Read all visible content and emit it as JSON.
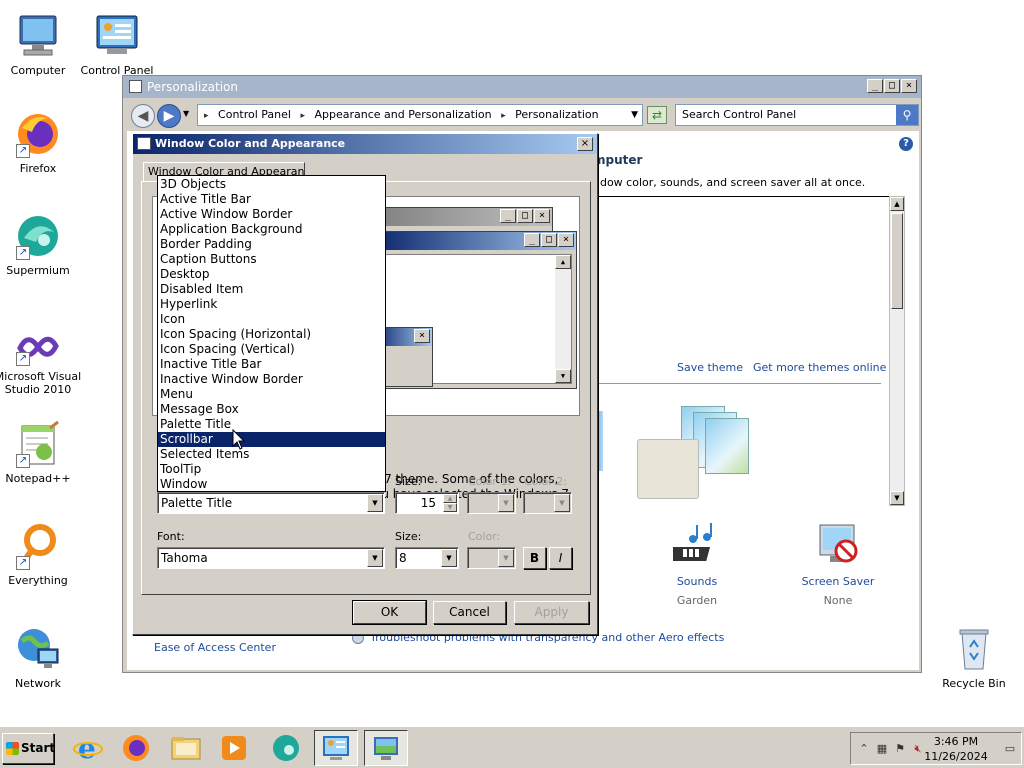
{
  "desktop": {
    "icons": [
      {
        "label": "Computer"
      },
      {
        "label": "Control Panel"
      },
      {
        "label": "Firefox"
      },
      {
        "label": "Supermium"
      },
      {
        "label": "Microsoft Visual Studio 2010"
      },
      {
        "label": "Notepad++"
      },
      {
        "label": "Everything"
      },
      {
        "label": "Network"
      },
      {
        "label": "Recycle Bin"
      }
    ]
  },
  "personalization": {
    "title": "Personalization",
    "breadcrumbs": [
      "Control Panel",
      "Appearance and Personalization",
      "Personalization"
    ],
    "search_placeholder": "Search Control Panel",
    "heading_partial": "mputer",
    "subheading_partial": "ndow color, sounds, and screen saver all at once.",
    "save_theme": "Save theme",
    "get_more_themes": "Get more themes online",
    "sounds": {
      "label": "Sounds",
      "value": "Garden"
    },
    "screen_saver": {
      "label": "Screen Saver",
      "value": "None"
    },
    "ease_of_access": "Ease of Access Center",
    "troubleshoot": "Troubleshoot problems with transparency and other Aero effects"
  },
  "dialog": {
    "title": "Window Color and Appearance",
    "tab_label": "Window Color and Appearance",
    "description_line1": "s 7 theme.  Some of the colors,",
    "description_line2": "ou have selected the Windows 7",
    "item_selected": "Palette Title",
    "size_label": "Size:",
    "item_size": "15",
    "color1_label": "Color 1:",
    "color2_label": "Color 2:",
    "font_label": "Font:",
    "font_value": "Tahoma",
    "font_size_label": "Size:",
    "font_size": "8",
    "color_label": "Color:",
    "bold_label": "B",
    "italic_label": "I",
    "ok": "OK",
    "cancel": "Cancel",
    "apply": "Apply",
    "item_options": [
      "3D Objects",
      "Active Title Bar",
      "Active Window Border",
      "Application Background",
      "Border Padding",
      "Caption Buttons",
      "Desktop",
      "Disabled Item",
      "Hyperlink",
      "Icon",
      "Icon Spacing (Horizontal)",
      "Icon Spacing (Vertical)",
      "Inactive Title Bar",
      "Inactive Window Border",
      "Menu",
      "Message Box",
      "Palette Title",
      "Scrollbar",
      "Selected Items",
      "ToolTip",
      "Window"
    ],
    "highlighted_option": "Scrollbar"
  },
  "taskbar": {
    "start_label": "Start",
    "time": "3:46 PM",
    "date": "11/26/2024"
  },
  "colors": {
    "selection": "#0a246a",
    "link": "#1e4b9a",
    "face": "#d4d0c8"
  }
}
